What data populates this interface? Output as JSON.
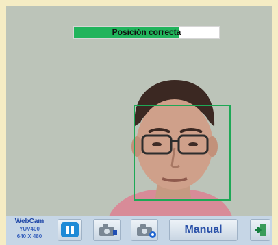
{
  "status": {
    "text": "Posición correcta",
    "progress": 0.72,
    "fill_color": "#21b45c"
  },
  "detection": {
    "box_color": "#1ea856"
  },
  "camera": {
    "name": "WebCam",
    "format": "YUV400",
    "resolution": "640 X 480"
  },
  "toolbar": {
    "pause_icon": "pause-icon",
    "camera_icon_1": "camera-icon",
    "camera_icon_2": "camera-settings-icon",
    "manual_label": "Manual",
    "exit_icon": "exit-door-icon"
  }
}
